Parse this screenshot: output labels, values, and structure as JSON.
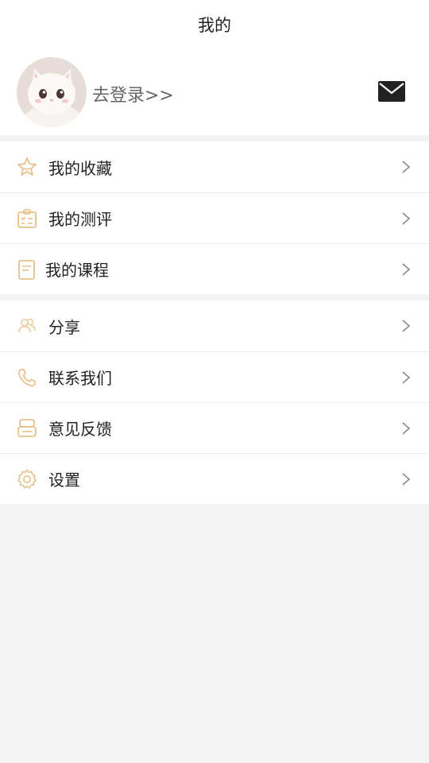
{
  "header": {
    "title": "我的"
  },
  "profile": {
    "login_text": "去登录>>",
    "avatar_icon": "cat-avatar",
    "mail_icon": "mail-icon"
  },
  "menu_group_1": [
    {
      "label": "我的收藏",
      "icon": "star-icon"
    },
    {
      "label": "我的测评",
      "icon": "clipboard-check-icon"
    },
    {
      "label": "我的课程",
      "icon": "document-icon"
    }
  ],
  "menu_group_2": [
    {
      "label": "分享",
      "icon": "users-icon"
    },
    {
      "label": "联系我们",
      "icon": "phone-icon"
    },
    {
      "label": "意见反馈",
      "icon": "feedback-icon"
    },
    {
      "label": "设置",
      "icon": "gear-icon"
    }
  ],
  "colors": {
    "accent_icon": "#e8c08a",
    "chevron": "#8a8a8a",
    "background": "#f4f4f4"
  }
}
